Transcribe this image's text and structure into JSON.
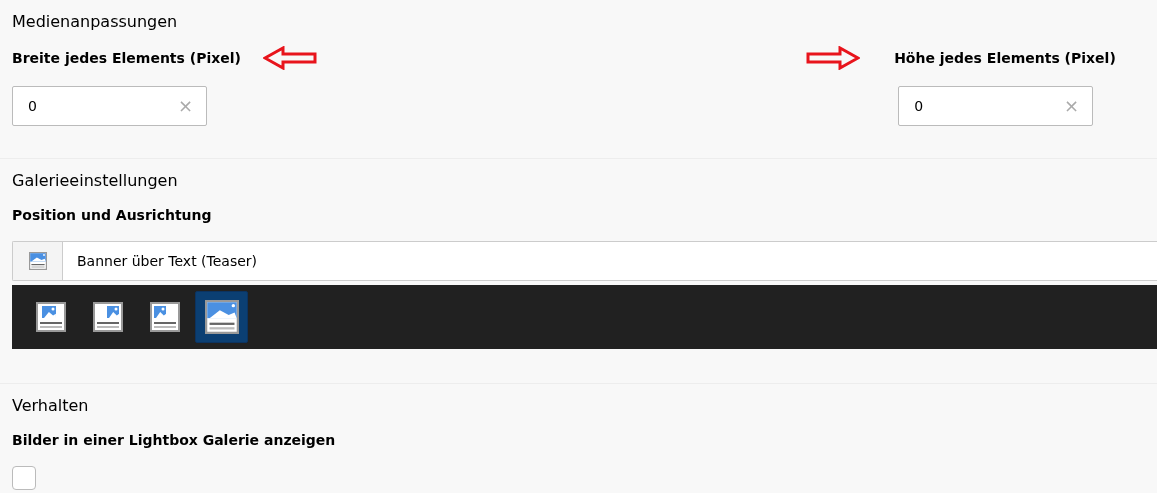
{
  "sections": [
    {
      "title": "Medienanpassungen",
      "fields": [
        {
          "label": "Breite jedes Elements (Pixel)",
          "value": "0",
          "clear": "×",
          "annotation": {
            "kind": "left"
          }
        },
        {
          "label": "Höhe jedes Elements (Pixel)",
          "value": "0",
          "clear": "×",
          "annotation": {
            "kind": "right"
          }
        }
      ]
    },
    {
      "title": "Galerieeinstellungen",
      "label": "Position und Ausrichtung",
      "select": {
        "value": "Banner über Text (Teaser)"
      },
      "options": [
        {
          "kind": "center",
          "selected": false
        },
        {
          "kind": "right",
          "selected": false
        },
        {
          "kind": "left",
          "selected": false
        },
        {
          "kind": "banner",
          "selected": true
        }
      ]
    },
    {
      "title": "Verhalten",
      "label": "Bilder in einer Lightbox Galerie anzeigen",
      "checkbox": {
        "checked": false
      }
    }
  ]
}
